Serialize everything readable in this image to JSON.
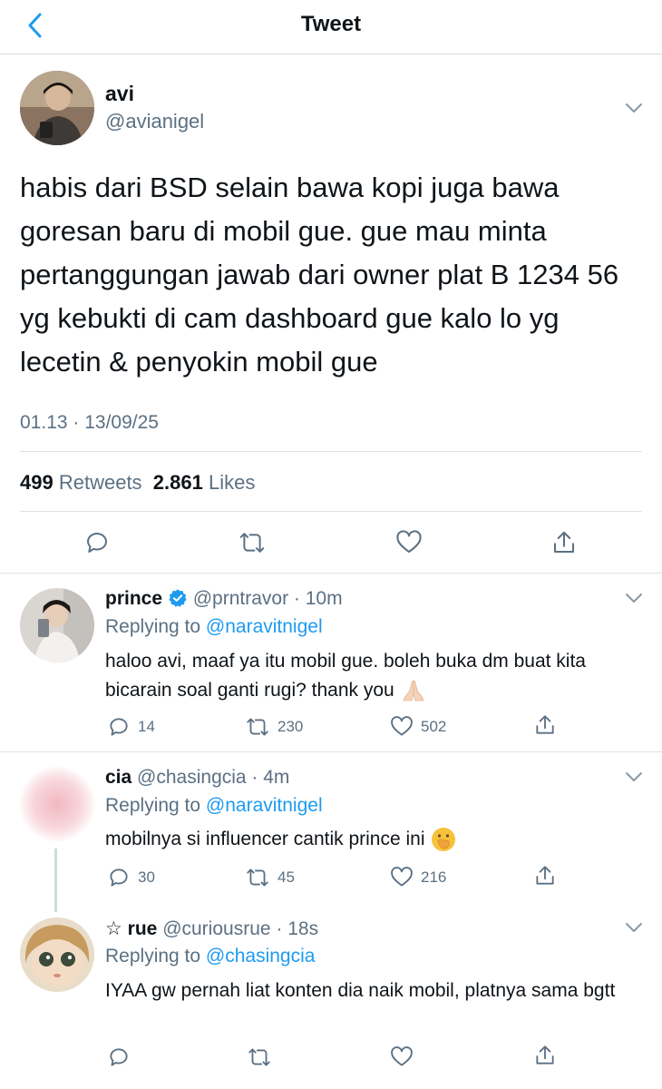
{
  "header": {
    "title": "Tweet"
  },
  "main_tweet": {
    "name": "avi",
    "handle": "@avianigel",
    "text": "habis dari BSD selain bawa kopi juga bawa goresan baru di mobil gue. gue mau minta pertanggungan jawab dari owner plat B 1234 56 yg kebukti di cam dashboard gue kalo lo yg lecetin & penyokin mobil gue",
    "timestamp": "01.13 · 13/09/25",
    "retweets_count": "499",
    "retweets_label": "Retweets",
    "likes_count": "2.861",
    "likes_label": "Likes"
  },
  "replies": [
    {
      "name": "prince",
      "handle_time": "@prntravor · 10m",
      "replying_prefix": "Replying to",
      "replying_to": "@naravitnigel",
      "text": "haloo avi, maaf ya itu mobil gue. boleh buka dm buat kita bicarain soal ganti rugi? thank you",
      "comments": "14",
      "retweets": "230",
      "likes": "502"
    },
    {
      "name": "cia",
      "handle_time": "@chasingcia · 4m",
      "replying_prefix": "Replying to",
      "replying_to": "@naravitnigel",
      "text": "mobilnya si influencer cantik prince ini",
      "comments": "30",
      "retweets": "45",
      "likes": "216"
    },
    {
      "name": "☆ rue",
      "handle_time": "@curiousrue · 18s",
      "replying_prefix": "Replying to",
      "replying_to": "@chasingcia",
      "text": "IYAA gw pernah liat konten dia naik mobil, platnya sama bgtt"
    }
  ],
  "colors": {
    "accent": "#1d9bf0",
    "muted": "#5b7083",
    "divider": "#dde2e6",
    "verified": "#1d9bf0"
  }
}
